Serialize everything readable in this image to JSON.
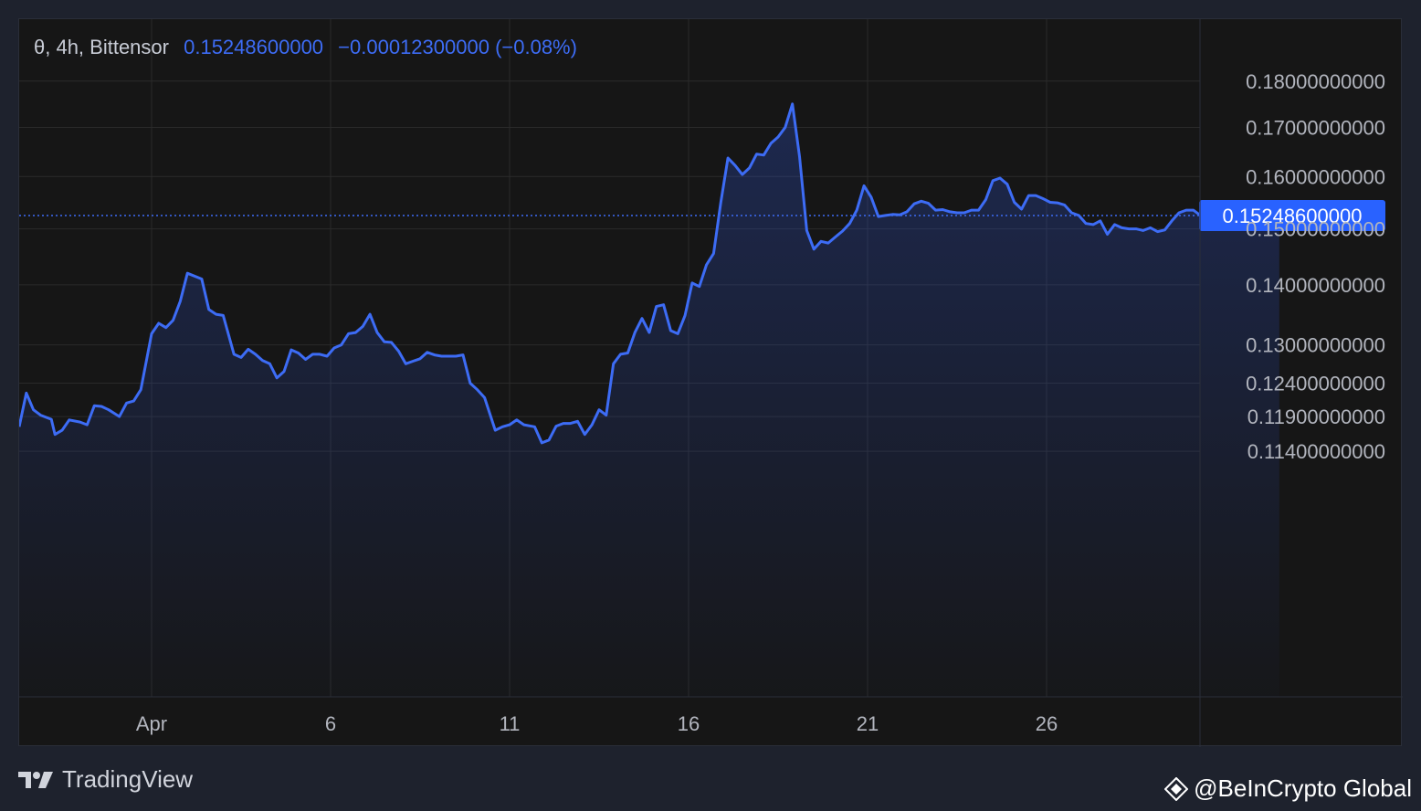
{
  "legend": {
    "symbol": "θ, 4h, Bittensor",
    "price": "0.15248600000",
    "change": "−0.00012300000 (−0.08%)"
  },
  "branding": {
    "platform": "TradingView",
    "watermark": "@BeInCrypto Global"
  },
  "colors": {
    "line": "#3d6cf5",
    "background": "#161616",
    "grid": "#2a2a2a",
    "label_bg": "#2962ff"
  },
  "chart_data": {
    "type": "area",
    "title": "",
    "xlabel": "",
    "ylabel": "",
    "interval": "4h",
    "x_ticks": [
      "Apr",
      "6",
      "11",
      "16",
      "21",
      "26"
    ],
    "x_tick_days": [
      1,
      6,
      11,
      16,
      21,
      26
    ],
    "x_range_days": [
      -2.7,
      31.9
    ],
    "y_ticks": [
      "0.18000000000",
      "0.17000000000",
      "0.16000000000",
      "0.15000000000",
      "0.14000000000",
      "0.13000000000",
      "0.12400000000",
      "0.11900000000",
      "0.11400000000"
    ],
    "y_tick_values": [
      0.18,
      0.17,
      0.16,
      0.15,
      0.14,
      0.13,
      0.124,
      0.119,
      0.114
    ],
    "y_scale": "log",
    "ylim": [
      0.1125,
      0.182
    ],
    "current_price": 0.152486,
    "current_price_label": "0.15248600000",
    "grid": true,
    "series": [
      {
        "points": [
          [
            -2.7,
            0.1175
          ],
          [
            -2.5,
            0.1225
          ],
          [
            -2.3,
            0.12
          ],
          [
            -2.1,
            0.1192
          ],
          [
            -1.8,
            0.1186
          ],
          [
            -1.7,
            0.1164
          ],
          [
            -1.5,
            0.117
          ],
          [
            -1.3,
            0.1185
          ],
          [
            -1.0,
            0.1182
          ],
          [
            -0.8,
            0.1178
          ],
          [
            -0.6,
            0.1206
          ],
          [
            -0.4,
            0.1205
          ],
          [
            -0.2,
            0.12
          ],
          [
            0.1,
            0.119
          ],
          [
            0.3,
            0.121
          ],
          [
            0.5,
            0.1213
          ],
          [
            0.7,
            0.123
          ],
          [
            1.0,
            0.1318
          ],
          [
            1.2,
            0.1335
          ],
          [
            1.4,
            0.1328
          ],
          [
            1.6,
            0.134
          ],
          [
            1.8,
            0.1372
          ],
          [
            2.0,
            0.142
          ],
          [
            2.4,
            0.141
          ],
          [
            2.6,
            0.1358
          ],
          [
            2.8,
            0.135
          ],
          [
            3.0,
            0.1348
          ],
          [
            3.3,
            0.1285
          ],
          [
            3.5,
            0.128
          ],
          [
            3.7,
            0.1293
          ],
          [
            3.9,
            0.1285
          ],
          [
            4.1,
            0.1275
          ],
          [
            4.3,
            0.127
          ],
          [
            4.5,
            0.1248
          ],
          [
            4.7,
            0.1258
          ],
          [
            4.9,
            0.1292
          ],
          [
            5.1,
            0.1287
          ],
          [
            5.3,
            0.1277
          ],
          [
            5.5,
            0.1285
          ],
          [
            5.7,
            0.1285
          ],
          [
            5.9,
            0.1282
          ],
          [
            6.1,
            0.1295
          ],
          [
            6.3,
            0.13
          ],
          [
            6.5,
            0.1318
          ],
          [
            6.7,
            0.132
          ],
          [
            6.9,
            0.133
          ],
          [
            7.1,
            0.135
          ],
          [
            7.3,
            0.132
          ],
          [
            7.5,
            0.1305
          ],
          [
            7.7,
            0.1304
          ],
          [
            7.9,
            0.129
          ],
          [
            8.1,
            0.127
          ],
          [
            8.3,
            0.1274
          ],
          [
            8.5,
            0.1278
          ],
          [
            8.7,
            0.1288
          ],
          [
            8.9,
            0.1284
          ],
          [
            9.1,
            0.1282
          ],
          [
            9.3,
            0.1282
          ],
          [
            9.5,
            0.1282
          ],
          [
            9.7,
            0.1284
          ],
          [
            9.9,
            0.124
          ],
          [
            10.1,
            0.123
          ],
          [
            10.3,
            0.1218
          ],
          [
            10.6,
            0.117
          ],
          [
            10.8,
            0.1175
          ],
          [
            11.0,
            0.1178
          ],
          [
            11.2,
            0.1185
          ],
          [
            11.4,
            0.1178
          ],
          [
            11.7,
            0.1175
          ],
          [
            11.9,
            0.1152
          ],
          [
            12.1,
            0.1156
          ],
          [
            12.3,
            0.1176
          ],
          [
            12.5,
            0.118
          ],
          [
            12.7,
            0.118
          ],
          [
            12.9,
            0.1183
          ],
          [
            13.1,
            0.1164
          ],
          [
            13.3,
            0.1178
          ],
          [
            13.5,
            0.12
          ],
          [
            13.7,
            0.1192
          ],
          [
            13.9,
            0.127
          ],
          [
            14.1,
            0.1285
          ],
          [
            14.3,
            0.1287
          ],
          [
            14.5,
            0.132
          ],
          [
            14.7,
            0.1343
          ],
          [
            14.9,
            0.132
          ],
          [
            15.1,
            0.1363
          ],
          [
            15.3,
            0.1366
          ],
          [
            15.5,
            0.1323
          ],
          [
            15.7,
            0.1318
          ],
          [
            15.9,
            0.1348
          ],
          [
            16.1,
            0.1403
          ],
          [
            16.3,
            0.1397
          ],
          [
            16.5,
            0.1435
          ],
          [
            16.7,
            0.1455
          ],
          [
            16.9,
            0.155
          ],
          [
            17.1,
            0.1637
          ],
          [
            17.3,
            0.1622
          ],
          [
            17.5,
            0.1604
          ],
          [
            17.7,
            0.1617
          ],
          [
            17.9,
            0.1645
          ],
          [
            18.1,
            0.1643
          ],
          [
            18.3,
            0.1667
          ],
          [
            18.5,
            0.168
          ],
          [
            18.7,
            0.17
          ],
          [
            18.9,
            0.175
          ],
          [
            19.1,
            0.164
          ],
          [
            19.3,
            0.1497
          ],
          [
            19.5,
            0.1463
          ],
          [
            19.7,
            0.1477
          ],
          [
            19.9,
            0.1474
          ],
          [
            20.1,
            0.1485
          ],
          [
            20.3,
            0.1496
          ],
          [
            20.5,
            0.151
          ],
          [
            20.7,
            0.1535
          ],
          [
            20.9,
            0.1582
          ],
          [
            21.1,
            0.156
          ],
          [
            21.3,
            0.1523
          ],
          [
            21.5,
            0.1525
          ],
          [
            21.7,
            0.1527
          ],
          [
            21.9,
            0.1526
          ],
          [
            22.1,
            0.1532
          ],
          [
            22.3,
            0.1547
          ],
          [
            22.5,
            0.1552
          ],
          [
            22.7,
            0.1548
          ],
          [
            22.9,
            0.1535
          ],
          [
            23.1,
            0.1536
          ],
          [
            23.3,
            0.1532
          ],
          [
            23.5,
            0.153
          ],
          [
            23.7,
            0.153
          ],
          [
            23.9,
            0.1535
          ],
          [
            24.1,
            0.1535
          ],
          [
            24.3,
            0.1555
          ],
          [
            24.5,
            0.1592
          ],
          [
            24.7,
            0.1597
          ],
          [
            24.9,
            0.1585
          ],
          [
            25.1,
            0.155
          ],
          [
            25.3,
            0.1537
          ],
          [
            25.5,
            0.1563
          ],
          [
            25.7,
            0.1563
          ],
          [
            25.9,
            0.1557
          ],
          [
            26.1,
            0.155
          ],
          [
            26.3,
            0.1549
          ],
          [
            26.5,
            0.1545
          ],
          [
            26.7,
            0.153
          ],
          [
            26.9,
            0.1525
          ],
          [
            27.1,
            0.151
          ],
          [
            27.3,
            0.1508
          ],
          [
            27.5,
            0.1515
          ],
          [
            27.7,
            0.149
          ],
          [
            27.9,
            0.1508
          ],
          [
            28.1,
            0.1502
          ],
          [
            28.3,
            0.15
          ],
          [
            28.5,
            0.15
          ],
          [
            28.7,
            0.1497
          ],
          [
            28.9,
            0.1502
          ],
          [
            29.1,
            0.1495
          ],
          [
            29.3,
            0.1498
          ],
          [
            29.5,
            0.1515
          ],
          [
            29.7,
            0.153
          ],
          [
            29.9,
            0.1535
          ],
          [
            30.1,
            0.1535
          ],
          [
            30.3,
            0.1525
          ],
          [
            30.5,
            0.152
          ],
          [
            30.7,
            0.1515
          ],
          [
            30.9,
            0.1513
          ],
          [
            31.1,
            0.151
          ],
          [
            31.3,
            0.1505
          ],
          [
            31.5,
            0.151
          ],
          [
            31.7,
            0.1512
          ],
          [
            31.9,
            0.1506
          ],
          [
            32.1,
            0.151
          ],
          [
            32.3,
            0.1525
          ],
          [
            32.5,
            0.1527
          ]
        ]
      }
    ]
  }
}
